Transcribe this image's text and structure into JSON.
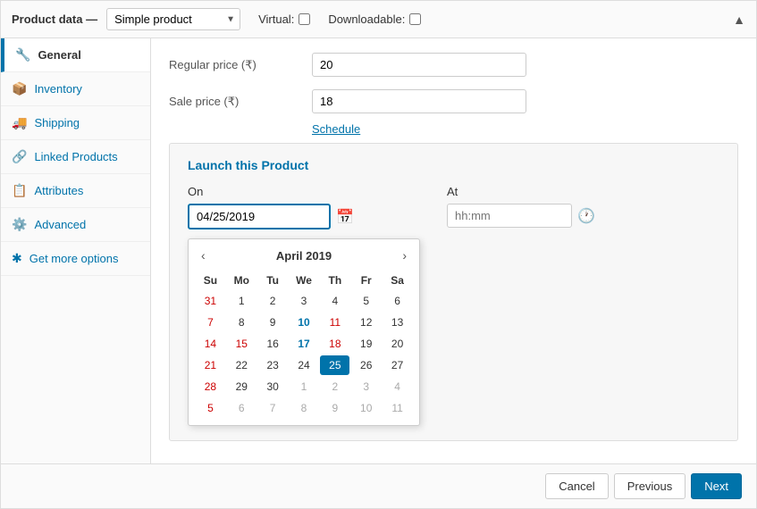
{
  "header": {
    "label": "Product data —",
    "product_type": "Simple product",
    "virtual_label": "Virtual:",
    "downloadable_label": "Downloadable:"
  },
  "sidebar": {
    "items": [
      {
        "id": "general",
        "label": "General",
        "icon": "🔧",
        "active": true
      },
      {
        "id": "inventory",
        "label": "Inventory",
        "icon": "📦"
      },
      {
        "id": "shipping",
        "label": "Shipping",
        "icon": "🚚"
      },
      {
        "id": "linked-products",
        "label": "Linked Products",
        "icon": "🔗"
      },
      {
        "id": "attributes",
        "label": "Attributes",
        "icon": "📋"
      },
      {
        "id": "advanced",
        "label": "Advanced",
        "icon": "⚙️"
      },
      {
        "id": "get-more-options",
        "label": "Get more options",
        "icon": "✱"
      }
    ]
  },
  "form": {
    "regular_price_label": "Regular price (₹)",
    "regular_price_value": "20",
    "sale_price_label": "Sale price (₹)",
    "sale_price_value": "18",
    "schedule_link": "Schedule"
  },
  "launch_section": {
    "title": "Launch this Product",
    "on_label": "On",
    "at_label": "At",
    "date_value": "04/25/2019",
    "time_placeholder": "hh:mm"
  },
  "calendar": {
    "month_label": "April 2019",
    "day_headers": [
      "Su",
      "Mo",
      "Tu",
      "We",
      "Th",
      "Fr",
      "Sa"
    ],
    "weeks": [
      [
        {
          "day": "31",
          "other_month": true,
          "weekend": true
        },
        {
          "day": "1",
          "weekend": false
        },
        {
          "day": "2",
          "weekend": false
        },
        {
          "day": "3",
          "weekend": false
        },
        {
          "day": "4",
          "weekend": false
        },
        {
          "day": "5",
          "weekend": false
        },
        {
          "day": "6",
          "weekend": false
        }
      ],
      [
        {
          "day": "7",
          "weekend": true
        },
        {
          "day": "8",
          "weekend": false
        },
        {
          "day": "9",
          "weekend": false
        },
        {
          "day": "10",
          "weekend": false
        },
        {
          "day": "11",
          "weekend": false
        },
        {
          "day": "12",
          "weekend": false
        },
        {
          "day": "13",
          "weekend": false
        }
      ],
      [
        {
          "day": "14",
          "weekend": true
        },
        {
          "day": "15",
          "weekend": false
        },
        {
          "day": "16",
          "weekend": false
        },
        {
          "day": "17",
          "weekend": false
        },
        {
          "day": "18",
          "weekend": false
        },
        {
          "day": "19",
          "weekend": false
        },
        {
          "day": "20",
          "weekend": false
        }
      ],
      [
        {
          "day": "21",
          "weekend": true
        },
        {
          "day": "22",
          "weekend": false
        },
        {
          "day": "23",
          "weekend": false
        },
        {
          "day": "24",
          "weekend": false
        },
        {
          "day": "25",
          "weekend": false,
          "today": true
        },
        {
          "day": "26",
          "weekend": false
        },
        {
          "day": "27",
          "weekend": false
        }
      ],
      [
        {
          "day": "28",
          "weekend": true
        },
        {
          "day": "29",
          "weekend": false
        },
        {
          "day": "30",
          "weekend": false
        },
        {
          "day": "1",
          "other_month": true,
          "weekend": false
        },
        {
          "day": "2",
          "other_month": true,
          "weekend": false
        },
        {
          "day": "3",
          "other_month": true,
          "weekend": false
        },
        {
          "day": "4",
          "other_month": true,
          "weekend": false
        }
      ],
      [
        {
          "day": "5",
          "other_month": true,
          "weekend": true
        },
        {
          "day": "6",
          "other_month": true,
          "weekend": false
        },
        {
          "day": "7",
          "other_month": true,
          "weekend": false
        },
        {
          "day": "8",
          "other_month": true,
          "weekend": false
        },
        {
          "day": "9",
          "other_month": true,
          "weekend": false
        },
        {
          "day": "10",
          "other_month": true,
          "weekend": false
        },
        {
          "day": "11",
          "other_month": true,
          "weekend": false
        }
      ]
    ]
  },
  "buttons": {
    "cancel_label": "Cancel",
    "previous_label": "Previous",
    "next_label": "Next"
  },
  "colors": {
    "primary": "#0073aa",
    "weekend": "#cc0000"
  }
}
